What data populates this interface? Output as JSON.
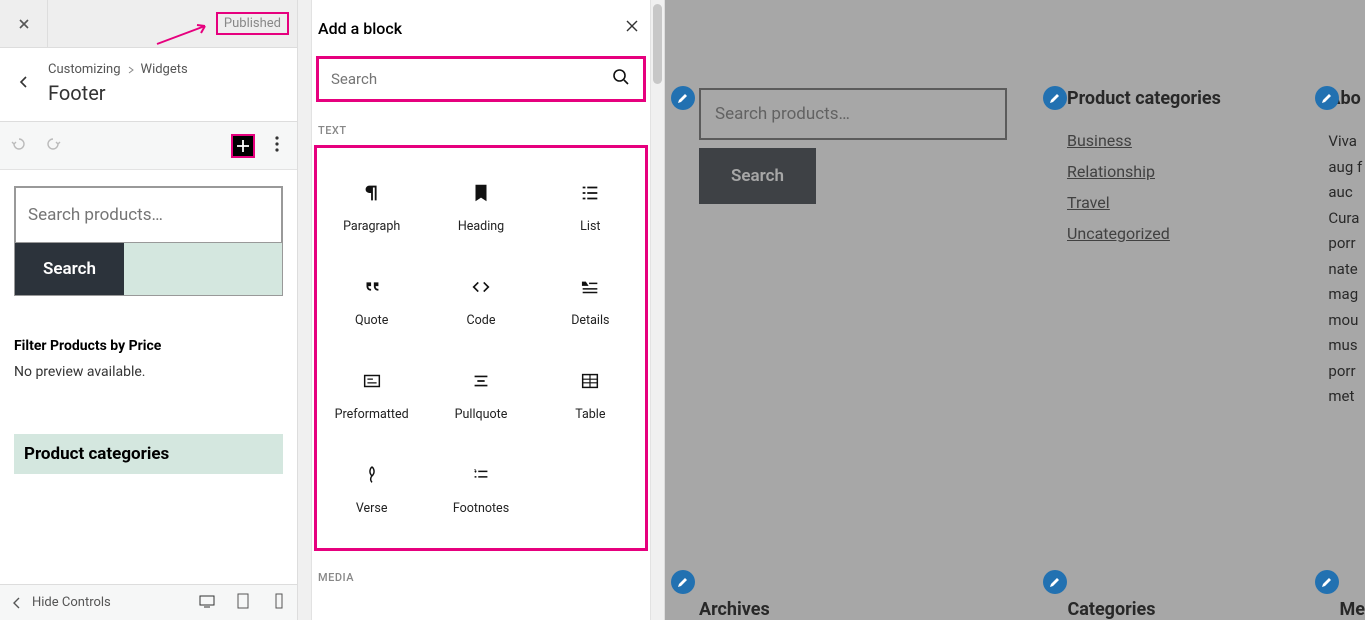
{
  "left": {
    "publish_label": "Published",
    "crumb_root": "Customizing",
    "crumb_item": "Widgets",
    "crumb_title": "Footer",
    "search_placeholder": "Search products…",
    "search_btn": "Search",
    "filter_title": "Filter Products by Price",
    "filter_text": "No preview available.",
    "cats_title": "Product categories",
    "hide_controls": "Hide Controls"
  },
  "block_panel": {
    "title": "Add a block",
    "search_placeholder": "Search",
    "section_text": "TEXT",
    "section_media": "MEDIA",
    "blocks": {
      "paragraph": "Paragraph",
      "heading": "Heading",
      "list": "List",
      "quote": "Quote",
      "code": "Code",
      "details": "Details",
      "preformatted": "Preformatted",
      "pullquote": "Pullquote",
      "table": "Table",
      "verse": "Verse",
      "footnotes": "Footnotes"
    }
  },
  "preview": {
    "search_placeholder": "Search products…",
    "search_btn": "Search",
    "cat_title": "Product categories",
    "cats": [
      "Business",
      "Relationship",
      "Travel",
      "Uncategorized"
    ],
    "about_title": "Abo",
    "about_text": "Viva aug fauc Cura porr nate mag mou mus porr met",
    "archives": "Archives",
    "categories": "Categories",
    "meta": "Me"
  }
}
